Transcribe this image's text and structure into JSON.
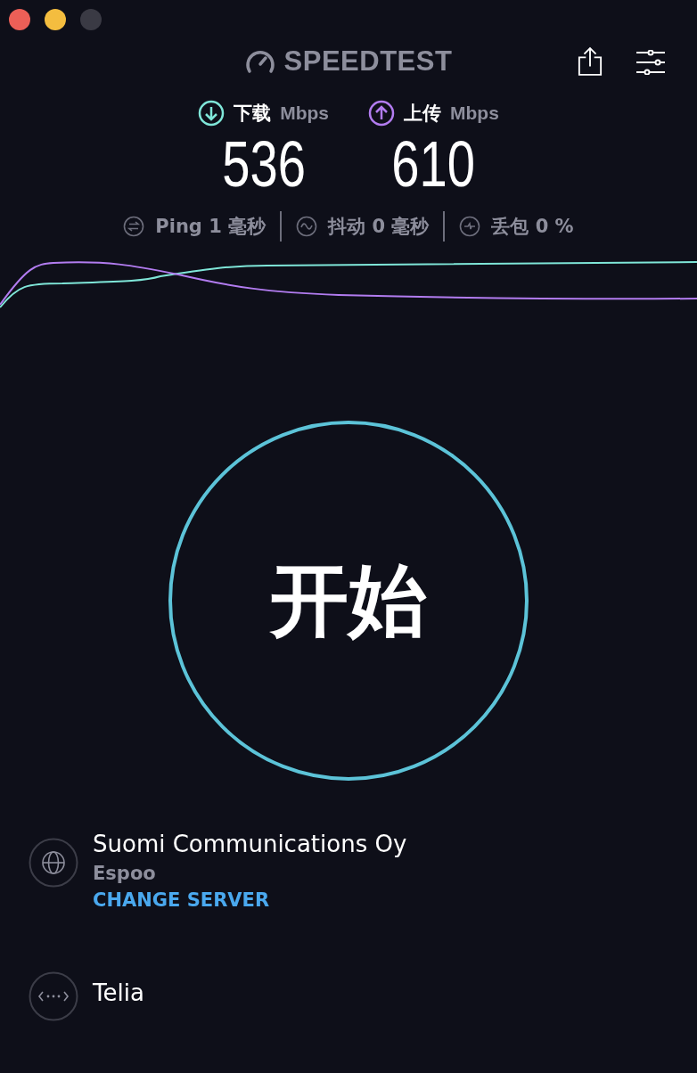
{
  "app": {
    "title": "SPEEDTEST"
  },
  "speeds": [
    {
      "kind": "download",
      "label": "下载",
      "unit": "Mbps",
      "value": "536"
    },
    {
      "kind": "upload",
      "label": "上传",
      "unit": "Mbps",
      "value": "610"
    }
  ],
  "stats": [
    {
      "kind": "ping",
      "text": "Ping 1 毫秒"
    },
    {
      "kind": "jitter",
      "text": "抖动 0 毫秒"
    },
    {
      "kind": "loss",
      "text": "丢包 0 %"
    }
  ],
  "start_button": {
    "label": "开始"
  },
  "server": {
    "name": "Suomi Communications Oy",
    "location": "Espoo",
    "change_label": "CHANGE SERVER"
  },
  "provider": {
    "name": "Telia"
  }
}
